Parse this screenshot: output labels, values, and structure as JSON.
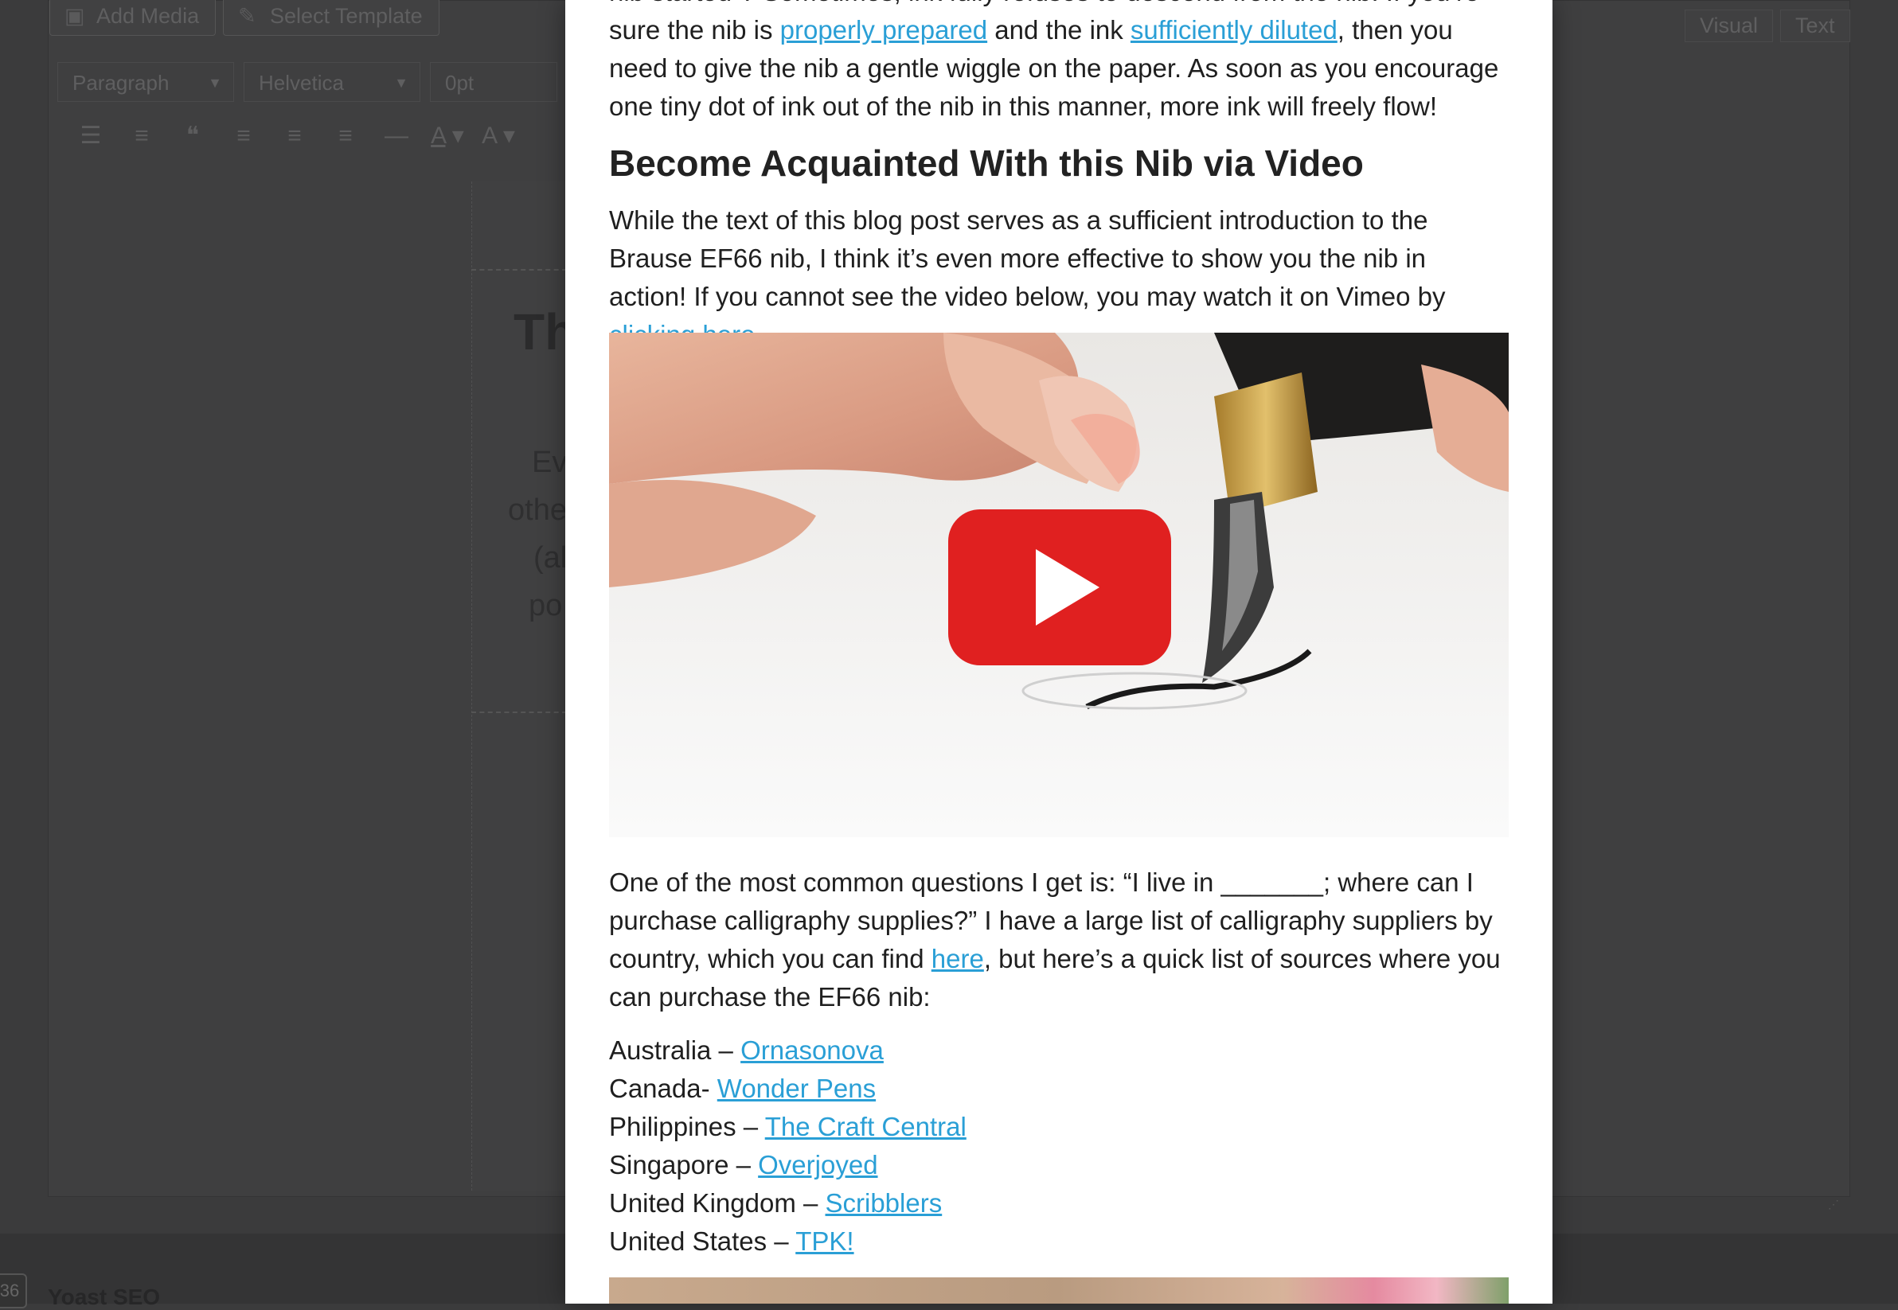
{
  "editor": {
    "add_media": "Add Media",
    "select_template": "Select Template",
    "tab_visual": "Visual",
    "tab_text": "Text",
    "format_select": "Paragraph",
    "font_select": "Helvetica",
    "size_select": "0pt",
    "sheet_title_fragment": "Th",
    "sheet_lines": [
      "Ev",
      "othe",
      "(al",
      "po"
    ],
    "yoast_label": "Yoast SEO",
    "count_badge": "36"
  },
  "article": {
    "top_para": {
      "line0": "nib started”? Sometimes, ink fully refuses to descend from the nib. If you’re",
      "prefix": "sure the nib is ",
      "link1": "properly prepared",
      "mid1": " and the ink ",
      "link2": "sufficiently diluted",
      "rest": ", then you need to give the nib a gentle wiggle on the paper. As soon as you encourage one tiny dot of ink out of the nib in this manner, more ink will freely flow!"
    },
    "heading": "Become Acquainted With this Nib via Video",
    "para2": {
      "text": "While the text of this blog post serves as a sufficient introduction to the Brause EF66 nib, I think it’s even more effective to show you the nib in action! If you cannot see the video below, you may watch it on Vimeo by ",
      "link": "clicking here",
      "end": "."
    },
    "video": {
      "play_icon": "play-icon"
    },
    "para3": {
      "text": "One of the most common questions I get is: “I live in _______; where can I purchase calligraphy supplies?” I have a large list of calligraphy suppliers by country, which you can find ",
      "link": "here",
      "end": ", but here’s a quick list of sources where you can purchase the EF66 nib:"
    },
    "suppliers": [
      {
        "country": "Australia – ",
        "store": "Ornasonova"
      },
      {
        "country": "Canada- ",
        "store": "Wonder Pens"
      },
      {
        "country": "Philippines – ",
        "store": "The Craft Central"
      },
      {
        "country": "Singapore – ",
        "store": "Overjoyed"
      },
      {
        "country": "United Kingdom – ",
        "store": "Scribblers"
      },
      {
        "country": "United States – ",
        "store": "TPK!"
      }
    ]
  },
  "colors": {
    "link": "#2a9fd6",
    "play_button": "#e02020",
    "overlay": "#3b3b3c"
  }
}
